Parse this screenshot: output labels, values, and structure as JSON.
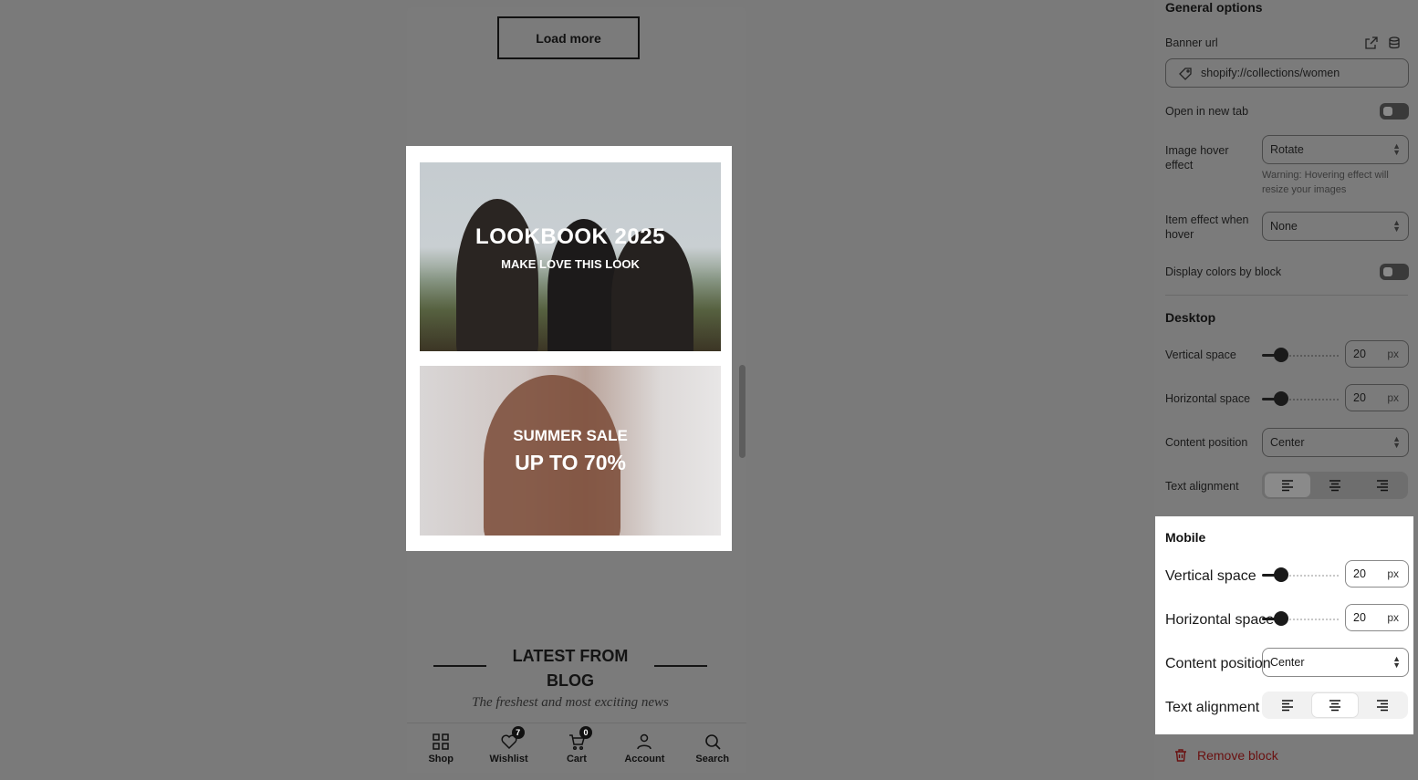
{
  "preview": {
    "load_more": "Load more",
    "banner1": {
      "title": "LOOKBOOK 2025",
      "subtitle": "MAKE LOVE THIS LOOK"
    },
    "banner2": {
      "title": "SUMMER SALE",
      "subtitle": "UP TO 70%"
    },
    "blog": {
      "title": "LATEST FROM BLOG",
      "subtitle": "The freshest and most exciting news"
    },
    "nav": [
      {
        "label": "Shop",
        "icon": "grid-icon"
      },
      {
        "label": "Wishlist",
        "icon": "heart-icon",
        "badge": "7"
      },
      {
        "label": "Cart",
        "icon": "cart-icon",
        "badge": "0"
      },
      {
        "label": "Account",
        "icon": "user-icon"
      },
      {
        "label": "Search",
        "icon": "search-icon"
      }
    ]
  },
  "panel": {
    "general_title": "General options",
    "banner_url_label": "Banner url",
    "banner_url_value": "shopify://collections/women",
    "open_new_tab_label": "Open in new tab",
    "image_hover_label": "Image hover effect",
    "image_hover_value": "Rotate",
    "image_hover_warning": "Warning: Hovering effect will resize your images",
    "item_effect_label": "Item effect when hover",
    "item_effect_value": "None",
    "display_colors_label": "Display colors by block",
    "desktop": {
      "title": "Desktop",
      "vertical_label": "Vertical space",
      "vertical_value": "20",
      "horizontal_label": "Horizontal space",
      "horizontal_value": "20",
      "unit": "px",
      "content_position_label": "Content position",
      "content_position_value": "Center",
      "text_alignment_label": "Text alignment",
      "text_alignment_selected": "left"
    },
    "mobile": {
      "title": "Mobile",
      "vertical_label": "Vertical space",
      "vertical_value": "20",
      "horizontal_label": "Horizontal space",
      "horizontal_value": "20",
      "unit": "px",
      "content_position_label": "Content position",
      "content_position_value": "Center",
      "text_alignment_label": "Text alignment",
      "text_alignment_selected": "center"
    },
    "remove_block": "Remove block"
  }
}
